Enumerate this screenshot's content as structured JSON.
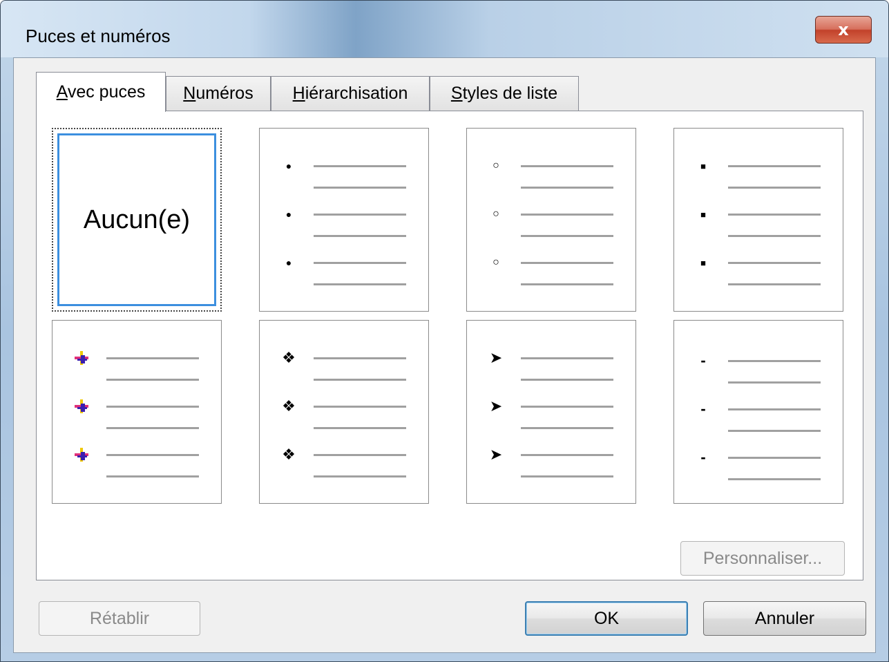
{
  "window": {
    "title": "Puces et numéros",
    "close_glyph": "x"
  },
  "tabs": [
    {
      "label": "Avec puces",
      "mnemonic": "A",
      "rest": "vec puces",
      "active": true
    },
    {
      "label": "Numéros",
      "mnemonic": "N",
      "rest": "uméros",
      "active": false
    },
    {
      "label": "Hiérarchisation",
      "mnemonic": "H",
      "rest": "iérarchisation",
      "active": false
    },
    {
      "label": "Styles de liste",
      "mnemonic": "S",
      "rest": "tyles de liste",
      "active": false
    }
  ],
  "bullet_styles": [
    {
      "name": "none",
      "label": "Aucun(e)",
      "selected": true
    },
    {
      "name": "filled-dot",
      "glyph": "●",
      "selected": false
    },
    {
      "name": "hollow-circle",
      "glyph": "○",
      "selected": false
    },
    {
      "name": "filled-square",
      "glyph": "■",
      "selected": false
    },
    {
      "name": "colored-cross-picture",
      "icon": "picture-bullet-icon",
      "selected": false
    },
    {
      "name": "four-diamonds",
      "glyph": "❖",
      "selected": false
    },
    {
      "name": "arrowhead",
      "glyph": "➤",
      "selected": false
    },
    {
      "name": "dash",
      "glyph": "-",
      "selected": false
    }
  ],
  "buttons": {
    "customize": {
      "label": "Personnaliser...",
      "enabled": false
    },
    "reset": {
      "label": "Rétablir",
      "enabled": false
    },
    "ok": {
      "label": "OK",
      "default": true
    },
    "cancel": {
      "label": "Annuler"
    }
  },
  "colors": {
    "selection_border": "#3c8fdf",
    "preview_line": "#a0a0a0",
    "close_button": "#c2412a"
  }
}
